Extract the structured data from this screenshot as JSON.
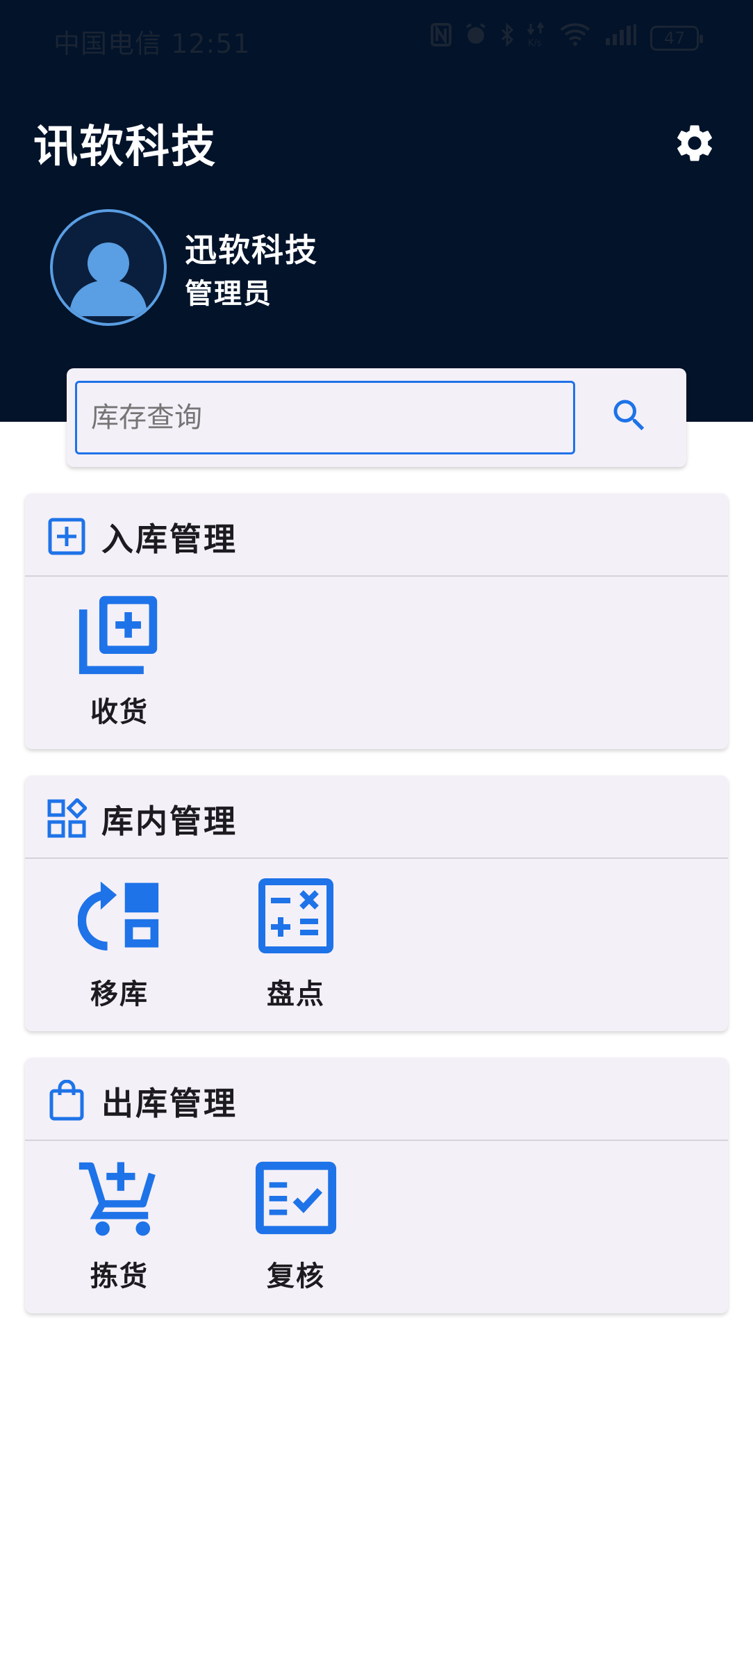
{
  "status_bar": {
    "carrier_time": "中国电信 12:51",
    "icons": [
      "nfc-icon",
      "alarm-icon",
      "bluetooth-icon",
      "data-speed-icon",
      "wifi-icon",
      "signal-icon"
    ],
    "battery": "47"
  },
  "header": {
    "title": "讯软科技",
    "background": "#02132a",
    "user": {
      "name": "迅软科技",
      "role": "管理员"
    }
  },
  "search": {
    "placeholder": "库存查询",
    "accent": "#1e73e8"
  },
  "sections": [
    {
      "title": "入库管理",
      "icon": "add-box-icon",
      "items": [
        {
          "label": "收货",
          "icon": "library-add-icon"
        }
      ]
    },
    {
      "title": "库内管理",
      "icon": "widgets-icon",
      "items": [
        {
          "label": "移库",
          "icon": "move-icon"
        },
        {
          "label": "盘点",
          "icon": "calculate-icon"
        }
      ]
    },
    {
      "title": "出库管理",
      "icon": "shopping-bag-icon",
      "items": [
        {
          "label": "拣货",
          "icon": "add-shopping-cart-icon"
        },
        {
          "label": "复核",
          "icon": "fact-check-icon"
        }
      ]
    }
  ]
}
